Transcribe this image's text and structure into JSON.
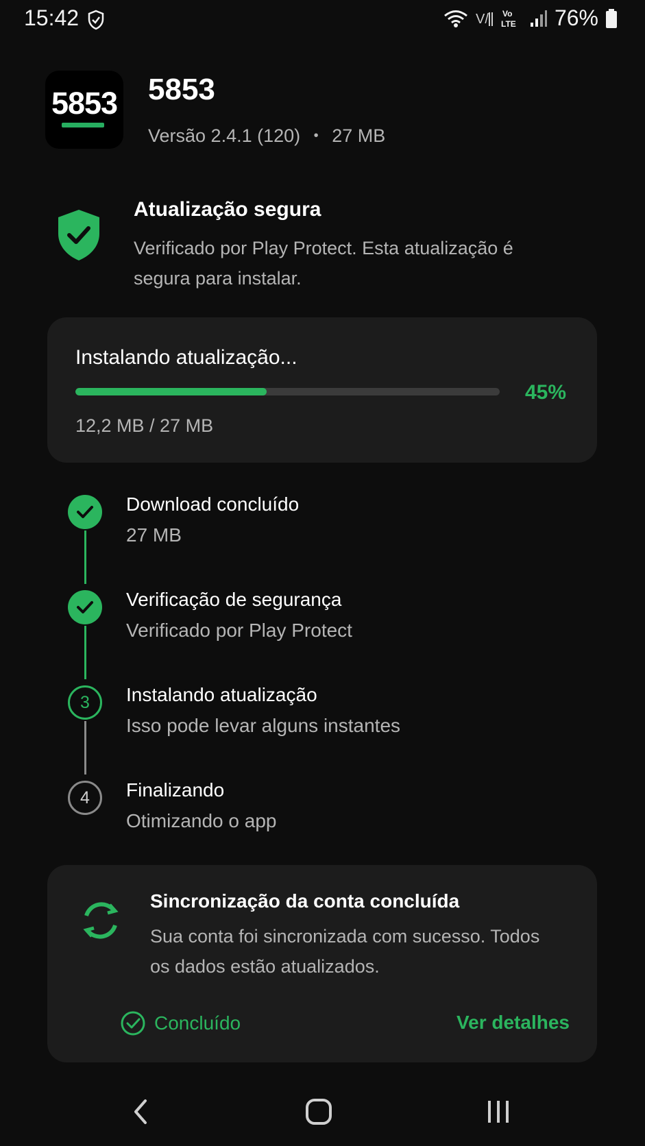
{
  "status_bar": {
    "time": "15:42",
    "battery": "76%",
    "icons": [
      "shield-check-icon",
      "wifi-icon",
      "volte-icon",
      "lte-icon",
      "signal-icon",
      "battery-icon"
    ]
  },
  "app": {
    "icon_text": "5853",
    "name": "5853",
    "version": "Versão 2.4.1 (120)",
    "separator": "•",
    "size": "27 MB"
  },
  "safe_update": {
    "title": "Atualização segura",
    "description": "Verificado por Play Protect. Esta atualização é segura para instalar."
  },
  "progress": {
    "title": "Instalando atualização...",
    "percent_label": "45%",
    "fraction": 0.45,
    "size_label": "12,2 MB / 27 MB"
  },
  "steps": [
    {
      "state": "done",
      "title": "Download concluído",
      "subtitle": "27 MB"
    },
    {
      "state": "done",
      "title": "Verificação de segurança",
      "subtitle": "Verificado por Play Protect"
    },
    {
      "state": "active",
      "number": "3",
      "title": "Instalando atualização",
      "subtitle": "Isso pode levar alguns instantes"
    },
    {
      "state": "pending",
      "number": "4",
      "title": "Finalizando",
      "subtitle": "Otimizando o app"
    }
  ],
  "sync": {
    "title": "Sincronização da conta concluída",
    "description": "Sua conta foi sincronizada com sucesso. Todos os dados estão atualizados.",
    "done_label": "Concluído",
    "details_label": "Ver detalhes"
  },
  "colors": {
    "accent": "#2bb55e",
    "background": "#0d0d0d",
    "card": "#1c1c1c"
  }
}
